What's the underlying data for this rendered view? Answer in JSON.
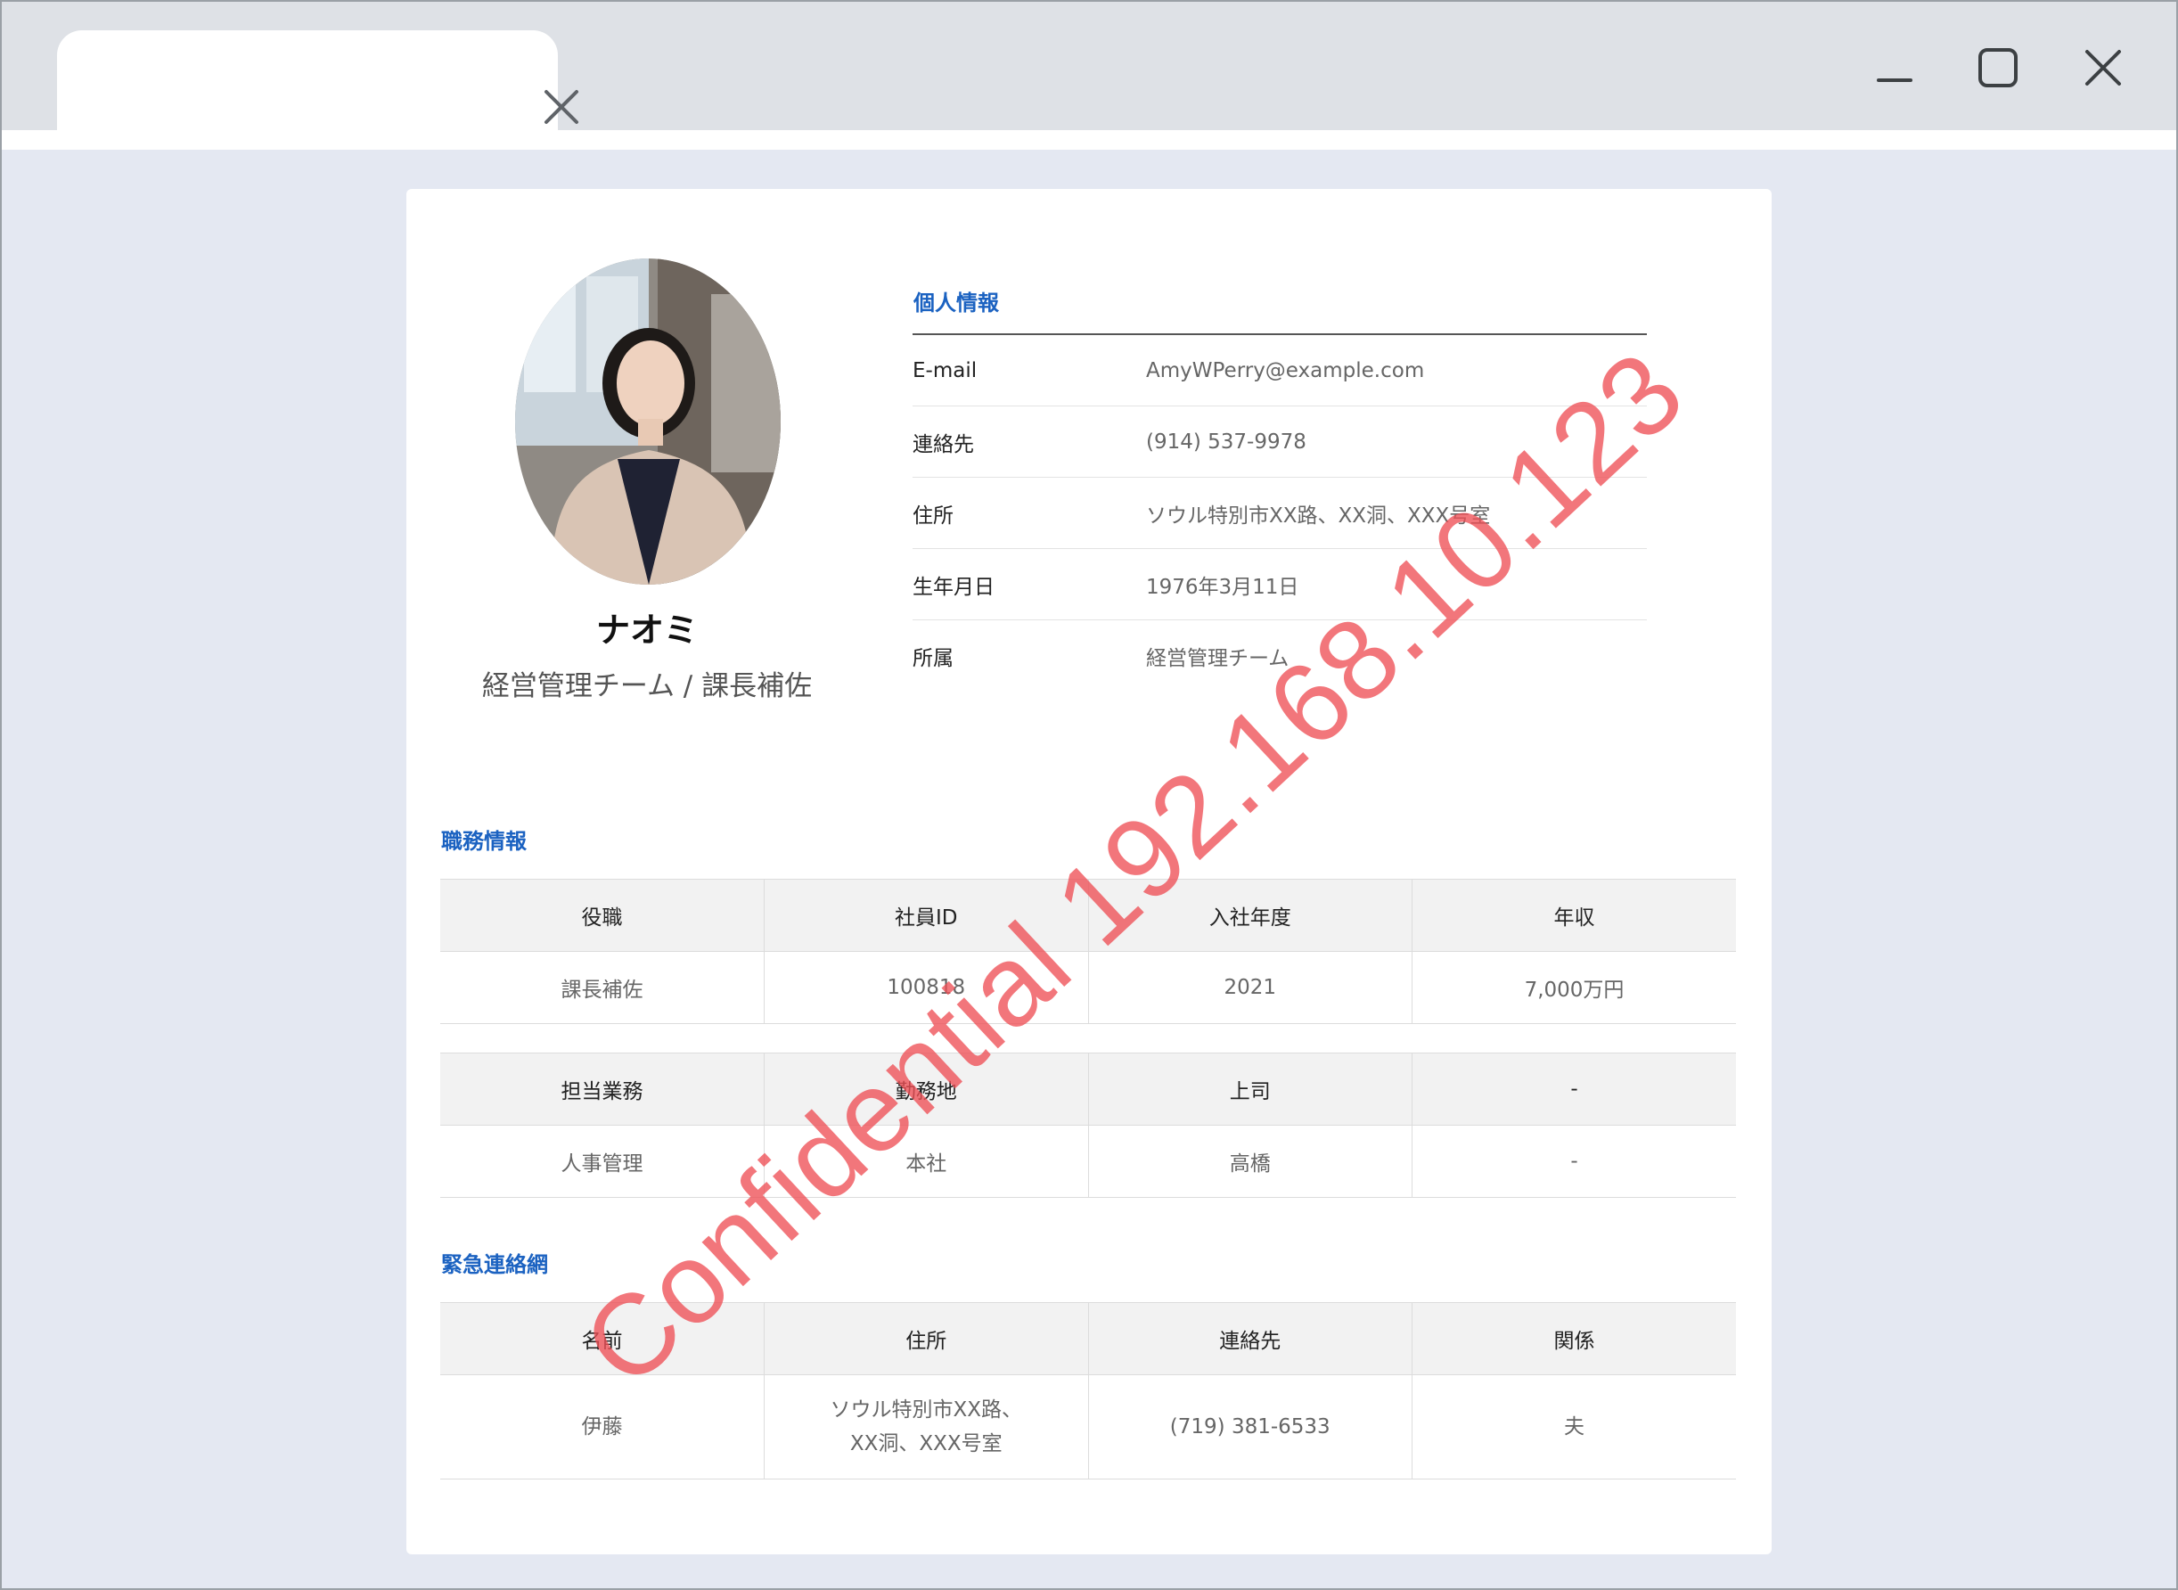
{
  "profile": {
    "name": "ナオミ",
    "role": "経営管理チーム / 課長補佐"
  },
  "personal": {
    "title": "個人情報",
    "rows": [
      {
        "label": "E-mail",
        "value": "AmyWPerry@example.com"
      },
      {
        "label": "連絡先",
        "value": "(914) 537-9978"
      },
      {
        "label": "住所",
        "value": "ソウル特別市XX路、XX洞、XXX号室"
      },
      {
        "label": "生年月日",
        "value": "1976年3月11日"
      },
      {
        "label": "所属",
        "value": "経営管理チーム"
      }
    ]
  },
  "job": {
    "title": "職務情報",
    "table1": {
      "headers": [
        "役職",
        "社員ID",
        "入社年度",
        "年収"
      ],
      "values": [
        "課長補佐",
        "100818",
        "2021",
        "7,000万円"
      ]
    },
    "table2": {
      "headers": [
        "担当業務",
        "勤務地",
        "上司",
        "-"
      ],
      "values": [
        "人事管理",
        "本社",
        "高橋",
        "-"
      ]
    }
  },
  "emergency": {
    "title": "緊急連絡網",
    "headers": [
      "名前",
      "住所",
      "連絡先",
      "関係"
    ],
    "row": {
      "name": "伊藤",
      "address_line1": "ソウル特別市XX路、",
      "address_line2": "XX洞、XXX号室",
      "phone": "(719) 381-6533",
      "relation": "夫"
    }
  },
  "watermark": "Confidential 192.168.10.123"
}
